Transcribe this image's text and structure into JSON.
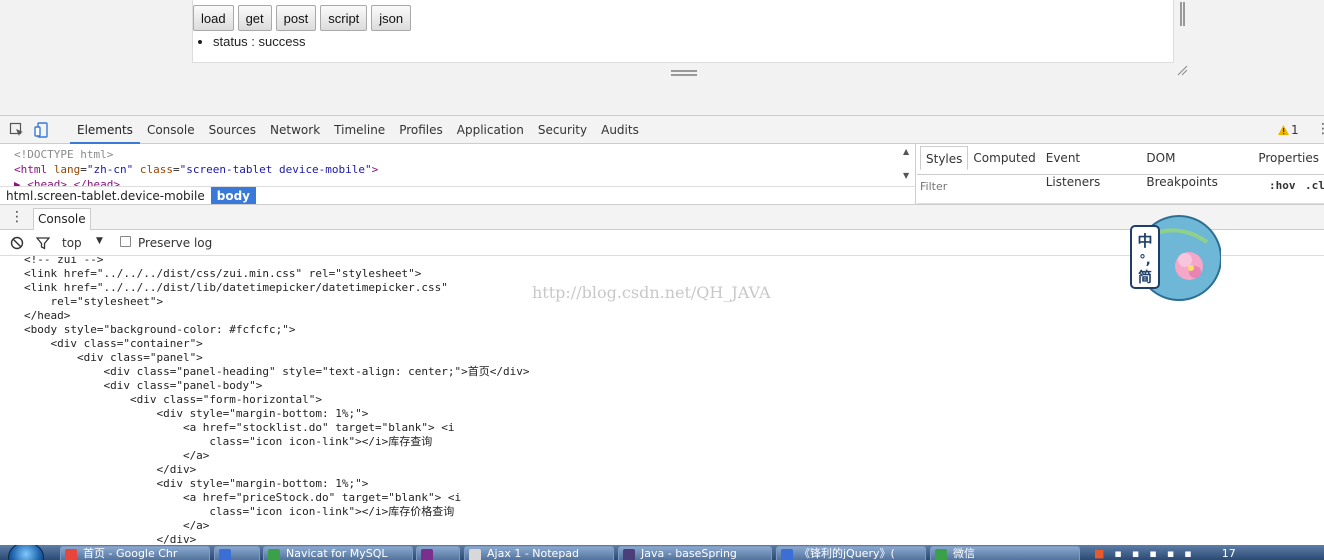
{
  "page": {
    "buttons": [
      "load",
      "get",
      "post",
      "script",
      "json"
    ],
    "status_text": "status : success"
  },
  "devtools": {
    "tabs": [
      "Elements",
      "Console",
      "Sources",
      "Network",
      "Timeline",
      "Profiles",
      "Application",
      "Security",
      "Audits"
    ],
    "active_tab": "Elements",
    "warning_count": "1",
    "elements_code": {
      "doctype": "<!DOCTYPE html>",
      "html_open_tag": "<html",
      "html_lang_attr": "lang",
      "html_lang_val": "\"zh-cn\"",
      "html_class_attr": "class",
      "html_class_val": "\"screen-tablet device-mobile\"",
      "html_close": ">",
      "head_line": "▶ <head>…</head>"
    },
    "breadcrumb": [
      "html.screen-tablet.device-mobile",
      "body"
    ],
    "styles_tabs": [
      "Styles",
      "Computed",
      "Event Listeners",
      "DOM Breakpoints",
      "Properties"
    ],
    "filter_placeholder": "Filter",
    "filter_hov": ":hov",
    "filter_cls": ".cl",
    "drawer_tab": "Console",
    "console_context": "top",
    "preserve_log_label": "Preserve log",
    "console_lines": [
      "<!-- zui -->",
      "<link href=\"../../../dist/css/zui.min.css\" rel=\"stylesheet\">",
      "<link href=\"../../../dist/lib/datetimepicker/datetimepicker.css\"",
      "    rel=\"stylesheet\">",
      "</head>",
      "<body style=\"background-color: #fcfcfc;\">",
      "    <div class=\"container\">",
      "        <div class=\"panel\">",
      "            <div class=\"panel-heading\" style=\"text-align: center;\">首页</div>",
      "            <div class=\"panel-body\">",
      "                <div class=\"form-horizontal\">",
      "                    <div style=\"margin-bottom: 1%;\">",
      "                        <a href=\"stocklist.do\" target=\"blank\"> <i",
      "                            class=\"icon icon-link\"></i>库存查询",
      "                        </a>",
      "                    </div>",
      "                    <div style=\"margin-bottom: 1%;\">",
      "                        <a href=\"priceStock.do\" target=\"blank\"> <i",
      "                            class=\"icon icon-link\"></i>库存价格查询",
      "                        </a>",
      "                    </div>"
    ],
    "watermark": "http://blog.csdn.net/QH_JAVA"
  },
  "ime": {
    "chars": [
      "中",
      "°,",
      "简"
    ]
  },
  "taskbar": {
    "items": [
      {
        "label": "首页 - Google Chr",
        "color": "#e8453c"
      },
      {
        "label": "",
        "color": "#3b6fd6"
      },
      {
        "label": "Navicat for MySQL",
        "color": "#3aa04a"
      },
      {
        "label": "",
        "color": "#7a2f8f"
      },
      {
        "label": "Ajax 1 - Notepad",
        "color": "#d8d8d8"
      },
      {
        "label": "Java - baseSpring",
        "color": "#4a3f7a"
      },
      {
        "label": "《锋利的jQuery》(",
        "color": "#3b6fd6"
      },
      {
        "label": "微信",
        "color": "#3aa04a"
      }
    ],
    "clock": "17"
  }
}
